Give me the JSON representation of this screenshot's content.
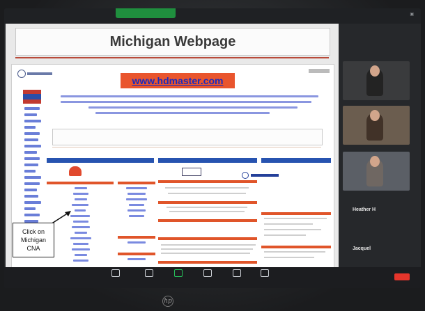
{
  "slide": {
    "title": "Michigan Webpage"
  },
  "website": {
    "url_banner": "www.hdmaster.com"
  },
  "callout": {
    "text_line1": "Click on",
    "text_line2": "Michigan",
    "text_line3": "CNA"
  },
  "participants": [
    {
      "name": "Heather H"
    },
    {
      "name": "Jacquel"
    }
  ],
  "colors": {
    "banner": "#e9552d",
    "url_text": "#1b2bbd",
    "column_header": "#2753b0",
    "section_bar": "#e0552a",
    "share_active": "#1f8f3e",
    "end_button": "#e5352b"
  },
  "icons": [
    "hp-logo-icon",
    "participants-icon",
    "chat-icon",
    "share-screen-icon",
    "record-icon",
    "reactions-icon",
    "more-icon"
  ]
}
